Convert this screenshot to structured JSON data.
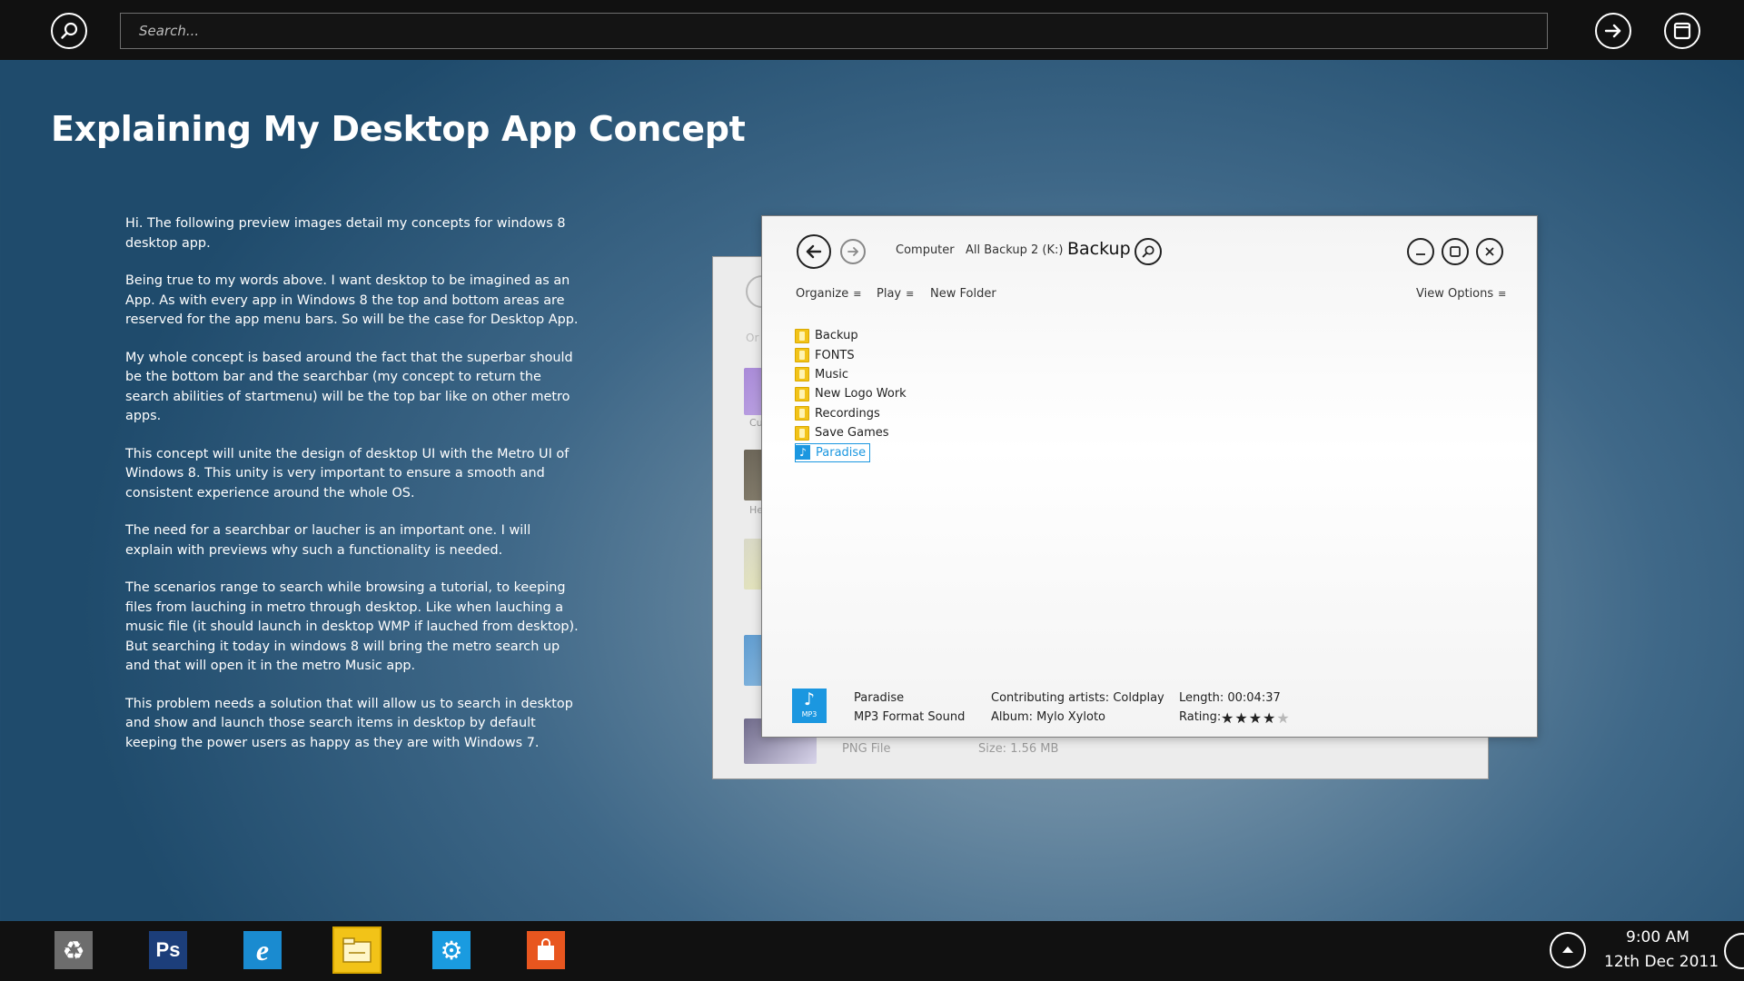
{
  "topbar": {
    "search_placeholder": "Search...",
    "search_icon": "search-icon",
    "go_icon": "arrow-right-icon",
    "window_icon": "window-icon"
  },
  "page": {
    "title": "Explaining My Desktop App Concept",
    "paragraphs": [
      "Hi. The following preview images detail my concepts for windows 8 desktop app.",
      "Being true to my words above. I want desktop to be imagined as an App. As with every app in Windows 8 the top and bottom areas are reserved for the app menu bars. So will be the case for Desktop App.",
      "My whole concept is based around the fact that the superbar should be the bottom bar and the searchbar (my concept to return the search abilities of startmenu) will be the top bar like on other metro apps.",
      "This concept will unite the design of desktop UI with the Metro UI of Windows 8. This unity is very important to ensure a smooth and consistent experience around the whole OS.",
      "The need for a searchbar or laucher is an important one. I will explain with previews why such a functionality is needed.",
      "The scenarios range to search while browsing a tutorial, to keeping files from lauching in metro through desktop. Like when lauching a music file (it should launch in desktop WMP if lauched from desktop). But searching it today in windows 8 will bring the metro search up and that will open it in the metro Music app.",
      "This problem needs a solution that will allow us to search in desktop and show and launch those search items in desktop by default keeping the power users as happy as they are with Windows 7."
    ]
  },
  "back_window": {
    "org_label": "Or",
    "labels": [
      "Cu",
      "He"
    ],
    "footer_type": "PNG File",
    "footer_size": "Size: 1.56 MB"
  },
  "explorer": {
    "breadcrumb": [
      "Computer",
      "All Backup 2 (K:)"
    ],
    "current": "Backup",
    "commands": {
      "organize": "Organize",
      "play": "Play",
      "new_folder": "New Folder",
      "view_options": "View Options",
      "menu_glyph": "≡"
    },
    "items": [
      {
        "label": "Backup",
        "type": "folder"
      },
      {
        "label": "FONTS",
        "type": "folder"
      },
      {
        "label": "Music",
        "type": "folder"
      },
      {
        "label": "New Logo Work",
        "type": "folder"
      },
      {
        "label": "Recordings",
        "type": "folder"
      },
      {
        "label": "Save Games",
        "type": "folder"
      },
      {
        "label": "Paradise",
        "type": "music",
        "selected": true
      }
    ],
    "details": {
      "tile_note": "♪",
      "tile_tag": "MP3",
      "name": "Paradise",
      "format": "MP3 Format Sound",
      "artists": "Contributing artists: Coldplay",
      "album": "Album: Mylo Xyloto",
      "length": "Length: 00:04:37",
      "rating_label": "Rating:",
      "rating": 4,
      "rating_max": 5
    }
  },
  "taskbar": {
    "apps": [
      {
        "name": "recycle-bin",
        "color": "#6d6d6d",
        "glyph": "♻"
      },
      {
        "name": "photoshop",
        "color": "#1c3e7a",
        "glyph": "Ps"
      },
      {
        "name": "internet-explorer",
        "color": "#1a8bd0",
        "glyph": "e"
      },
      {
        "name": "file-explorer",
        "color": "#f2c318",
        "glyph": ""
      },
      {
        "name": "settings",
        "color": "#1a9be0",
        "glyph": "⚙"
      },
      {
        "name": "store",
        "color": "#e8561f",
        "glyph": ""
      }
    ],
    "time": "9:00 AM",
    "date": "12th Dec 2011"
  }
}
